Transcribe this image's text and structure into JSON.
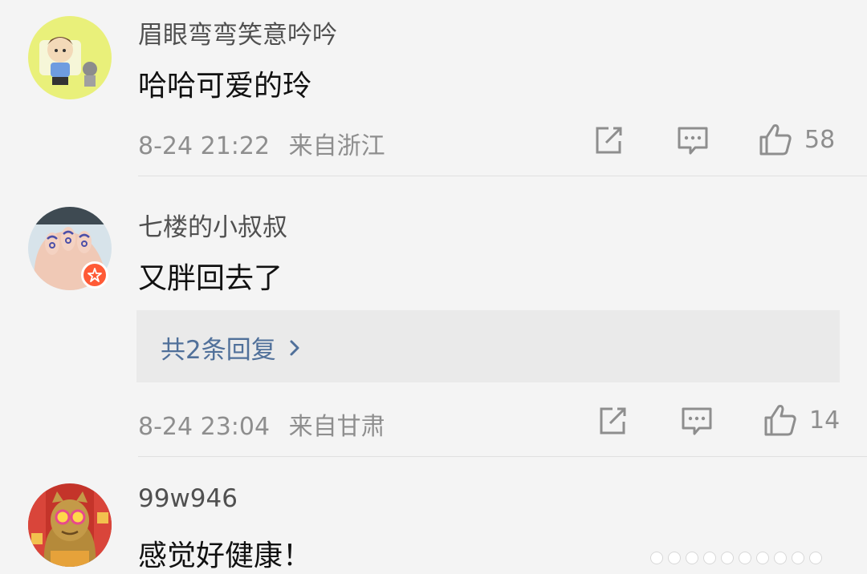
{
  "comments": [
    {
      "username": "眉眼弯弯笑意吟吟",
      "text": "哈哈可爱的玲",
      "time": "8-24 21:22",
      "location": "来自浙江",
      "likes": "58",
      "has_badge": false
    },
    {
      "username": "七楼的小叔叔",
      "text": "又胖回去了",
      "reply_summary": "共2条回复",
      "time": "8-24 23:04",
      "location": "来自甘肃",
      "likes": "14",
      "has_badge": true
    },
    {
      "username": "99w946",
      "text": "感觉好健康！"
    }
  ],
  "icons": {
    "share": "share-icon",
    "comment": "comment-icon",
    "like": "thumbs-up-icon",
    "reply_chevron": "chevron-right-icon",
    "badge": "star-badge-icon"
  },
  "colors": {
    "background": "#f4f4f4",
    "reply_box": "#eaeaea",
    "reply_link": "#50709a",
    "meta_text": "#8e8e8e",
    "username": "#505050",
    "badge": "#ff5a36"
  }
}
